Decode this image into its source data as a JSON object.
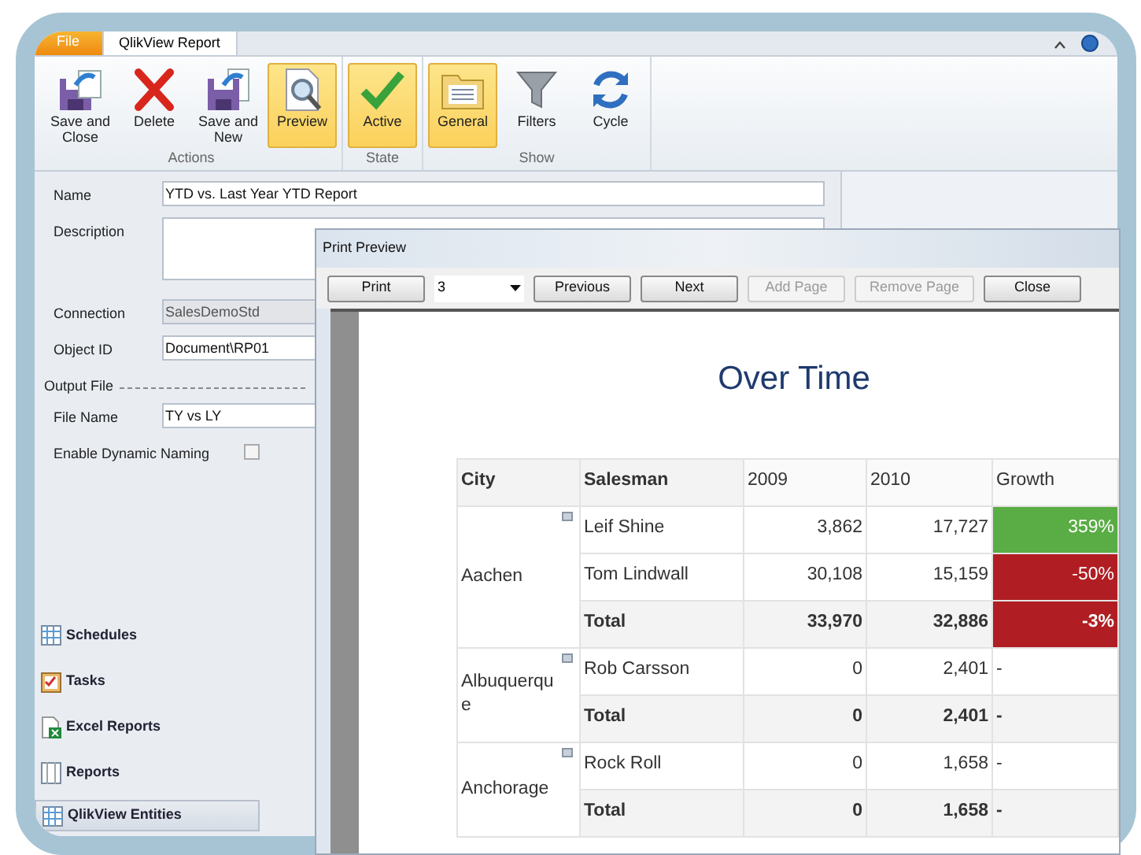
{
  "ribbon": {
    "tabs": [
      {
        "label": "File",
        "kind": "file",
        "selected": false
      },
      {
        "label": "QlikView Report",
        "kind": "tab",
        "selected": true
      }
    ],
    "groups": [
      {
        "label": "Actions",
        "buttons": [
          {
            "label": "Save and Close",
            "selected": false
          },
          {
            "label": "Delete",
            "selected": false
          },
          {
            "label": "Save and New",
            "selected": false
          },
          {
            "label": "Preview",
            "selected": true
          }
        ]
      },
      {
        "label": "State",
        "buttons": [
          {
            "label": "Active",
            "selected": true
          }
        ]
      },
      {
        "label": "Show",
        "buttons": [
          {
            "label": "General",
            "selected": true
          },
          {
            "label": "Filters",
            "selected": false
          },
          {
            "label": "Cycle",
            "selected": false
          }
        ]
      }
    ]
  },
  "form": {
    "fields": [
      {
        "label": "Name",
        "value": "YTD vs. Last Year YTD Report",
        "kind": "text",
        "disabled": false
      },
      {
        "label": "Description",
        "kind": "area"
      },
      {
        "label": "Connection",
        "value": "SalesDemoStd",
        "kind": "text",
        "disabled": true
      },
      {
        "label": "Object ID",
        "value": "Document\\RP01",
        "kind": "text",
        "disabled": false
      },
      {
        "label": "Output File",
        "kind": "section"
      },
      {
        "label": "File Name",
        "value": "TY vs LY",
        "kind": "text",
        "disabled": false
      },
      {
        "label": "Enable Dynamic Naming",
        "kind": "checkbox",
        "checked": false
      }
    ]
  },
  "navigation": [
    {
      "label": "Schedules",
      "kind": "link"
    },
    {
      "label": "Tasks",
      "kind": "link"
    },
    {
      "label": "Excel Reports",
      "kind": "link"
    },
    {
      "label": "Reports",
      "kind": "link"
    },
    {
      "label": "QlikView Entities",
      "kind": "bar"
    }
  ],
  "print_preview": {
    "title": "Print Preview",
    "buttons": [
      {
        "label": "Print",
        "disabled": false
      },
      {
        "label": "Previous",
        "disabled": false
      },
      {
        "label": "Next",
        "disabled": false
      },
      {
        "label": "Add Page",
        "disabled": true
      },
      {
        "label": "Remove Page",
        "disabled": true
      },
      {
        "label": "Close",
        "disabled": false
      }
    ],
    "page_select": "3",
    "report_title": "Over Time",
    "table": {
      "columns": [
        "City",
        "Salesman",
        "2009",
        "2010",
        "Growth"
      ],
      "groups": [
        {
          "city": "Aachen",
          "rows": [
            {
              "kind": "detail",
              "salesman": "Leif Shine",
              "y2009": "3,862",
              "y2010": "17,727",
              "growth": "359%",
              "color": "#5aac44"
            },
            {
              "kind": "detail",
              "salesman": "Tom Lindwall",
              "y2009": "30,108",
              "y2010": "15,159",
              "growth": "-50%",
              "color": "#b01e23"
            },
            {
              "kind": "total",
              "salesman": "Total",
              "y2009": "33,970",
              "y2010": "32,886",
              "growth": "-3%",
              "color": "#b01e23"
            }
          ]
        },
        {
          "city": "Albuquerque",
          "rows": [
            {
              "kind": "detail",
              "salesman": "Rob Carsson",
              "y2009": "0",
              "y2010": "2,401",
              "growth": "-"
            },
            {
              "kind": "total",
              "salesman": "Total",
              "y2009": "0",
              "y2010": "2,401",
              "growth": "-"
            }
          ]
        },
        {
          "city": "Anchorage",
          "rows": [
            {
              "kind": "detail",
              "salesman": "Rock Roll",
              "y2009": "0",
              "y2010": "1,658",
              "growth": "-"
            },
            {
              "kind": "total",
              "salesman": "Total",
              "y2009": "0",
              "y2010": "1,658",
              "growth": "-"
            }
          ]
        }
      ]
    }
  }
}
